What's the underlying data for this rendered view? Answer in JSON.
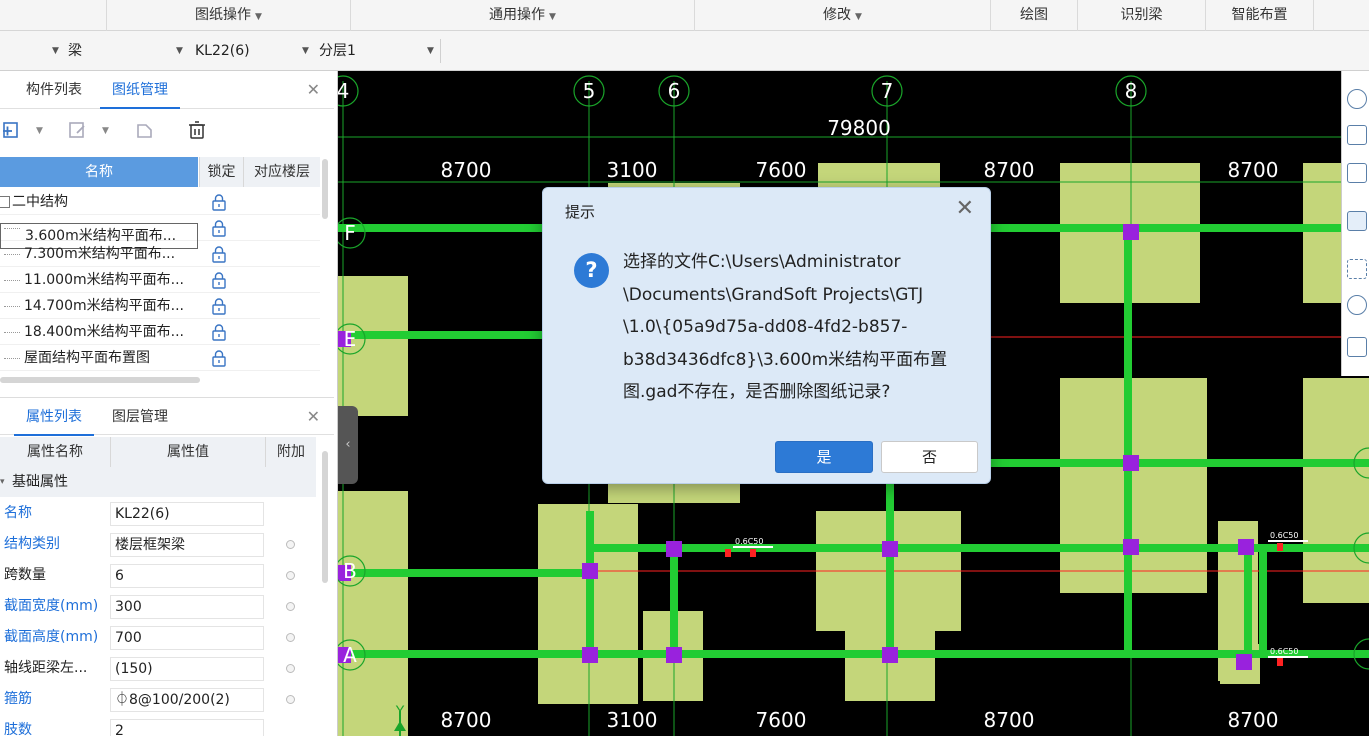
{
  "ribbon": {
    "groups": [
      "图纸操作",
      "通用操作",
      "修改",
      "绘图",
      "识别梁",
      "智能布置"
    ]
  },
  "selectors": {
    "type": "梁",
    "component": "KL22(6)",
    "layer": "分层1"
  },
  "drawing_panel": {
    "tabs": [
      "构件列表",
      "图纸管理"
    ],
    "active_tab": "图纸管理",
    "columns": [
      "名称",
      "锁定",
      "对应楼层"
    ],
    "group_label": "二中结构",
    "rows": [
      "3.600m米结构平面布...",
      "7.300m米结构平面布...",
      "11.000m米结构平面布...",
      "14.700m米结构平面布...",
      "18.400m米结构平面布...",
      "屋面结构平面布置图"
    ]
  },
  "property_panel": {
    "tabs": [
      "属性列表",
      "图层管理"
    ],
    "active_tab": "属性列表",
    "columns": [
      "属性名称",
      "属性值",
      "附加"
    ],
    "section": "基础属性",
    "rows": [
      {
        "name": "名称",
        "value": "KL22(6)",
        "blue": true,
        "check": false
      },
      {
        "name": "结构类别",
        "value": "楼层框架梁",
        "blue": true,
        "check": true
      },
      {
        "name": "跨数量",
        "value": "6",
        "blue": false,
        "check": true
      },
      {
        "name": "截面宽度(mm)",
        "value": "300",
        "blue": true,
        "check": true
      },
      {
        "name": "截面高度(mm)",
        "value": "700",
        "blue": true,
        "check": true
      },
      {
        "name": "轴线距梁左...",
        "value": "(150)",
        "blue": false,
        "check": true
      },
      {
        "name": "箍筋",
        "value": "⏀8@100/200(2)",
        "blue": true,
        "check": true
      },
      {
        "name": "肢数",
        "value": "2",
        "blue": true,
        "check": false
      }
    ]
  },
  "canvas": {
    "top_axes": [
      "4",
      "5",
      "6",
      "7",
      "8"
    ],
    "side_axes": [
      "F",
      "E",
      "B",
      "A"
    ],
    "total_dim": "79800",
    "top_dims": [
      "8700",
      "3100",
      "7600",
      "8700",
      "8700"
    ],
    "bottom_dims": [
      "8700",
      "3100",
      "7600",
      "8700",
      "8700"
    ],
    "beam_label": "0.6C50",
    "ucs_label": "Y"
  },
  "dialog": {
    "title": "提示",
    "message_lines": [
      "选择的文件C:\\Users\\Administrator",
      "\\Documents\\GrandSoft Projects\\GTJ",
      "\\1.0\\{05a9d75a-dd08-4fd2-b857-",
      "b38d3436dfc8}\\3.600m米结构平面布置",
      "图.gad不存在，是否删除图纸记录?"
    ],
    "yes_label": "是",
    "no_label": "否",
    "icon": "question-icon"
  },
  "colors": {
    "accent": "#1e6fd9",
    "column_fill": "#c4d67a",
    "beam": "#22cc33",
    "node": "#9922dd",
    "axis_line": "#ff2222",
    "dialog_bg": "#dce9f7"
  }
}
